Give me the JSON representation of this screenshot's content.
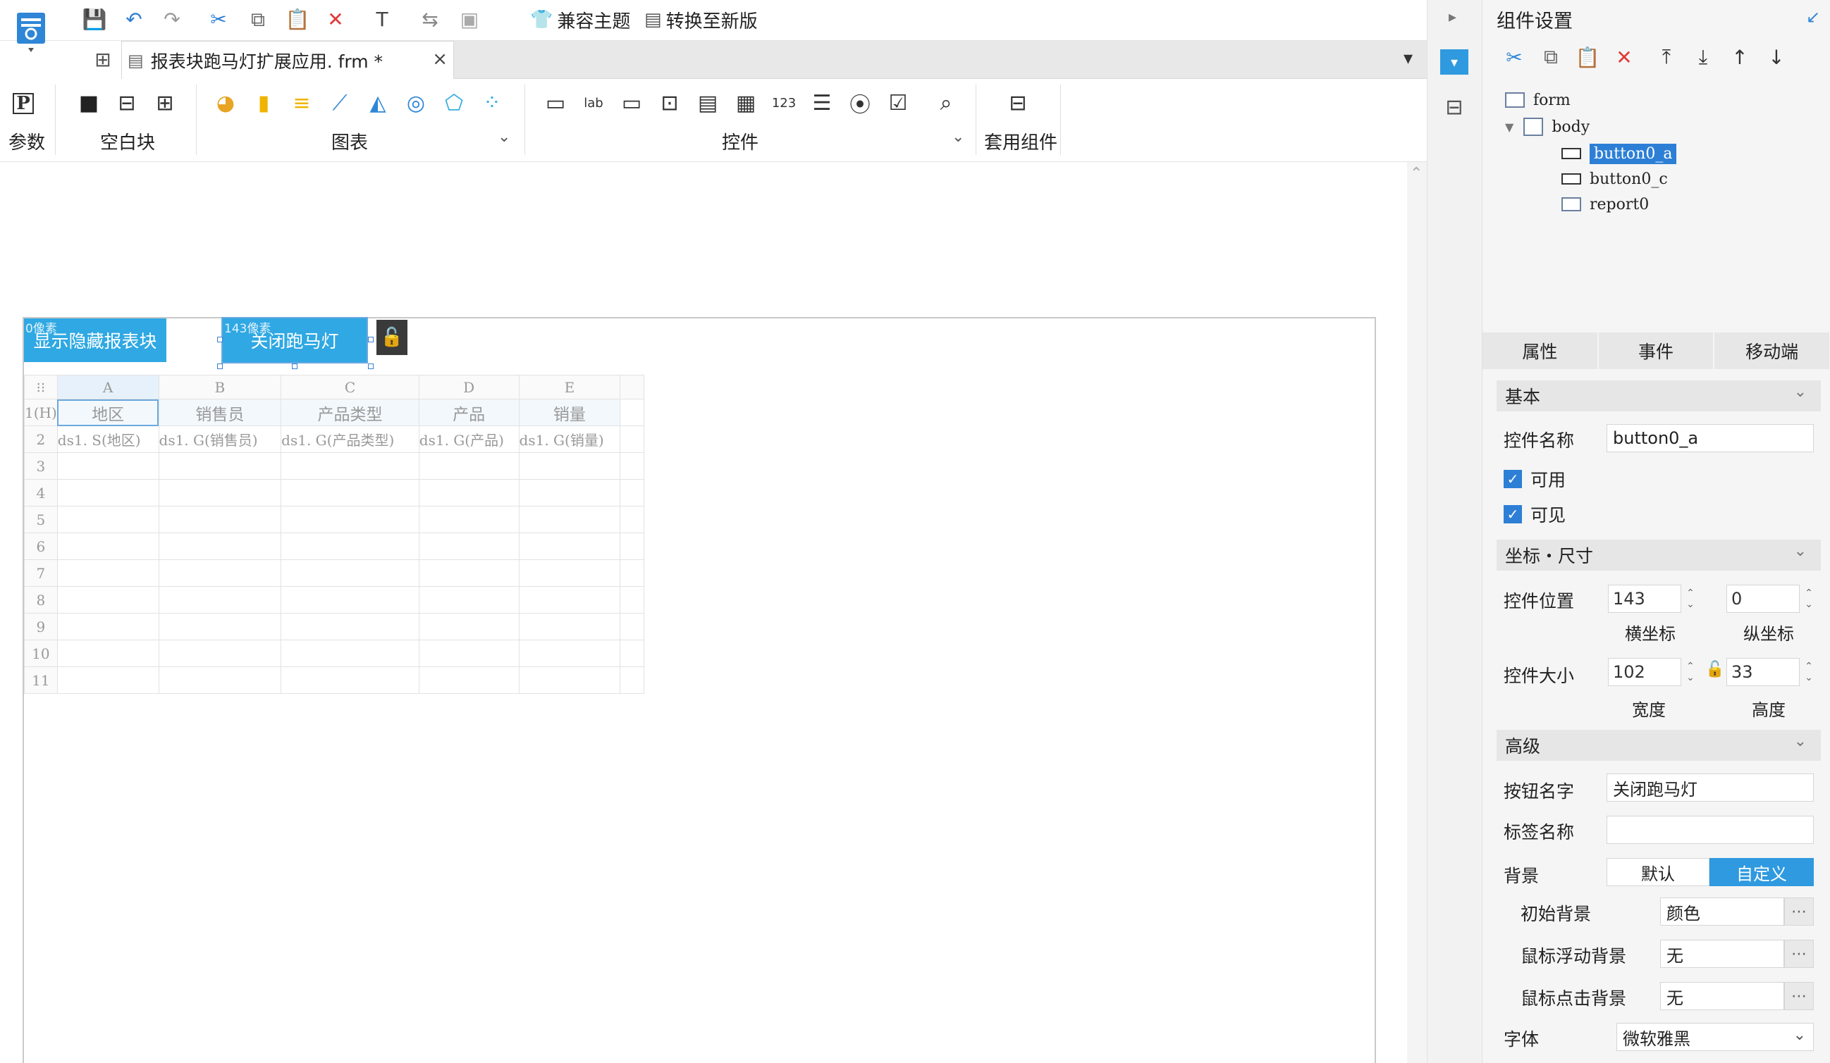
{
  "toolbar": {
    "compat_theme": "兼容主题",
    "convert_new": "转换至新版"
  },
  "document_tab": {
    "title": "报表块跑马灯扩展应用. frm *"
  },
  "ribbon": {
    "params": "参数",
    "blank_block": "空白块",
    "chart": "图表",
    "controls": "控件",
    "set_component": "套用组件"
  },
  "canvas": {
    "btn_show": {
      "label": "显示隐藏报表块",
      "pos": "0像素"
    },
    "btn_close": {
      "label": "关闭跑马灯",
      "pos": "143像素"
    },
    "columns": [
      "A",
      "B",
      "C",
      "D",
      "E"
    ],
    "row_numbers": [
      "1(H)",
      "2",
      "3",
      "4",
      "5",
      "6",
      "7",
      "8",
      "9",
      "10",
      "11"
    ],
    "header_row": [
      "地区",
      "销售员",
      "产品类型",
      "产品",
      "销量"
    ],
    "data_row": [
      "ds1. S(地区)",
      "ds1. G(销售员)",
      "ds1. G(产品类型)",
      "ds1. G(产品)",
      "ds1. G(销量)"
    ]
  },
  "panel": {
    "title": "组件设置",
    "tree": {
      "form": "form",
      "body": "body",
      "items": [
        "button0_a",
        "button0_c",
        "report0"
      ]
    },
    "tabs": [
      "属性",
      "事件",
      "移动端"
    ],
    "basic": {
      "section": "基本",
      "name_label": "控件名称",
      "name_value": "button0_a",
      "enabled": "可用",
      "visible": "可见"
    },
    "position": {
      "section": "坐标・尺寸",
      "pos_label": "控件位置",
      "x": "143",
      "y": "0",
      "x_label": "横坐标",
      "y_label": "纵坐标",
      "size_label": "控件大小",
      "w": "102",
      "h": "33",
      "w_label": "宽度",
      "h_label": "高度"
    },
    "advanced": {
      "section": "高级",
      "btn_name_label": "按钮名字",
      "btn_name_value": "关闭跑马灯",
      "tag_label": "标签名称",
      "tag_value": "",
      "bg_label": "背景",
      "bg_default": "默认",
      "bg_custom": "自定义",
      "init_bg_label": "初始背景",
      "init_bg_value": "颜色",
      "hover_bg_label": "鼠标浮动背景",
      "hover_bg_value": "无",
      "click_bg_label": "鼠标点击背景",
      "click_bg_value": "无",
      "font_label": "字体",
      "font_value": "微软雅黑"
    }
  },
  "colors": {
    "accent": "#2fa8e3",
    "selected": "#2d7fd6"
  }
}
